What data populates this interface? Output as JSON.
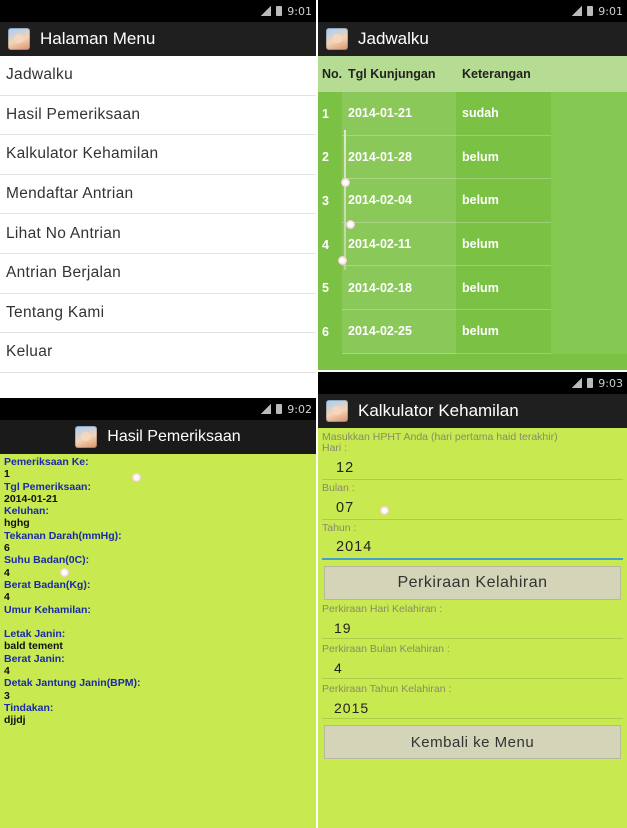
{
  "menu_screen": {
    "status_time": "9:01",
    "title": "Halaman Menu",
    "items": [
      {
        "label": "Jadwalku"
      },
      {
        "label": "Hasil Pemeriksaan"
      },
      {
        "label": "Kalkulator Kehamilan"
      },
      {
        "label": "Mendaftar Antrian"
      },
      {
        "label": "Lihat No Antrian"
      },
      {
        "label": "Antrian Berjalan"
      },
      {
        "label": "Tentang Kami"
      },
      {
        "label": "Keluar"
      }
    ]
  },
  "jadwal_screen": {
    "status_time": "9:01",
    "title": "Jadwalku",
    "headers": {
      "no": "No.",
      "tgl": "Tgl Kunjungan",
      "ket": "Keterangan"
    },
    "rows": [
      {
        "no": "1",
        "tgl": "2014-01-21",
        "ket": "sudah"
      },
      {
        "no": "2",
        "tgl": "2014-01-28",
        "ket": "belum"
      },
      {
        "no": "3",
        "tgl": "2014-02-04",
        "ket": "belum"
      },
      {
        "no": "4",
        "tgl": "2014-02-11",
        "ket": "belum"
      },
      {
        "no": "5",
        "tgl": "2014-02-18",
        "ket": "belum"
      },
      {
        "no": "6",
        "tgl": "2014-02-25",
        "ket": "belum"
      }
    ]
  },
  "hasil_screen": {
    "status_time": "9:02",
    "title": "Hasil Pemeriksaan",
    "fields": [
      {
        "label": "Pemeriksaan Ke:",
        "value": "1"
      },
      {
        "label": "Tgl Pemeriksaan:",
        "value": "2014-01-21"
      },
      {
        "label": "Keluhan:",
        "value": "hghg"
      },
      {
        "label": "Tekanan Darah(mmHg):",
        "value": "6"
      },
      {
        "label": "Suhu Badan(0C):",
        "value": "4"
      },
      {
        "label": "Berat Badan(Kg):",
        "value": "4"
      },
      {
        "label": "Umur Kehamilan:",
        "value": ""
      },
      {
        "label": "Letak Janin:",
        "value": "bald tement"
      },
      {
        "label": "Berat Janin:",
        "value": "4"
      },
      {
        "label": "Detak Jantung Janin(BPM):",
        "value": "3"
      },
      {
        "label": "Tindakan:",
        "value": "djjdj"
      }
    ]
  },
  "kalk_screen": {
    "status_time": "9:03",
    "title": "Kalkulator Kehamilan",
    "intro": "Masukkan HPHT Anda (hari pertama haid terakhir)",
    "hari_label": "Hari :",
    "hari_value": "12",
    "bulan_label": "Bulan :",
    "bulan_value": "07",
    "tahun_label": "Tahun :",
    "tahun_value": "2014",
    "calc_button": "Perkiraan Kelahiran",
    "est_hari_label": "Perkiraan Hari Kelahiran :",
    "est_hari_value": "19",
    "est_bulan_label": "Perkiraan Bulan Kelahiran :",
    "est_bulan_value": "4",
    "est_tahun_label": "Perkiraan Tahun Kelahiran :",
    "est_tahun_value": "2015",
    "back_button": "Kembali ke Menu"
  },
  "colors": {
    "jadwal_bg": "#7bc144",
    "form_bg": "#c8e94f",
    "label_blue": "#1a2aa8",
    "field_focus": "#45a0d0"
  },
  "icons": {
    "app": "baby-app-icon",
    "signal": "signal-icon",
    "battery": "battery-icon"
  }
}
